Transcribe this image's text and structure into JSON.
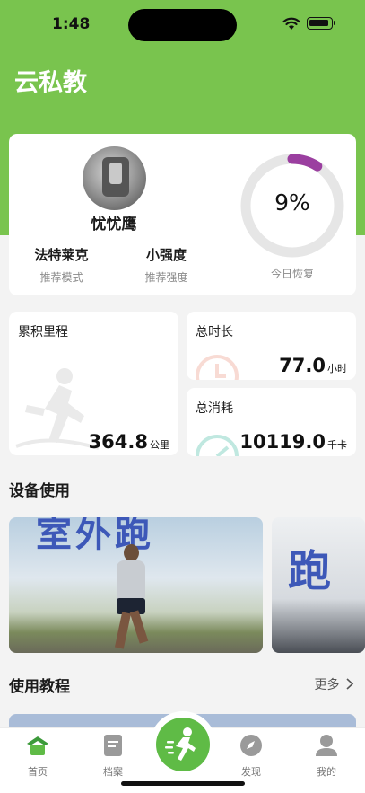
{
  "status_bar": {
    "time": "1:48"
  },
  "app": {
    "title": "云私教"
  },
  "profile": {
    "username": "忧忧鹰",
    "mode_value": "法特莱克",
    "mode_label": "推荐模式",
    "intensity_value": "小强度",
    "intensity_label": "推荐强度"
  },
  "recovery": {
    "percent_text": "9%",
    "percent_value": 9,
    "label": "今日恢复",
    "accent_color": "#9b3fa0"
  },
  "stats": {
    "mileage": {
      "label": "累积里程",
      "value": "364.8",
      "unit": "公里"
    },
    "duration": {
      "label": "总时长",
      "value": "77.0",
      "unit": "小时"
    },
    "calories": {
      "label": "总消耗",
      "value": "10119.0",
      "unit": "千卡"
    }
  },
  "devices": {
    "title": "设备使用",
    "items": [
      {
        "text": "室外跑",
        "image": "outdoor-runner"
      },
      {
        "text": "跑",
        "image": "treadmill"
      }
    ]
  },
  "tutorials": {
    "title": "使用教程",
    "more": "更多"
  },
  "tab_bar": {
    "items": [
      {
        "label": "首页",
        "icon": "home-icon"
      },
      {
        "label": "档案",
        "icon": "document-icon"
      },
      {
        "label": "",
        "icon": "runner-icon"
      },
      {
        "label": "发现",
        "icon": "compass-icon"
      },
      {
        "label": "我的",
        "icon": "user-icon"
      }
    ]
  },
  "colors": {
    "brand_green": "#79c44e",
    "center_button": "#5fbb46",
    "ring_track": "#e6e6e6"
  }
}
